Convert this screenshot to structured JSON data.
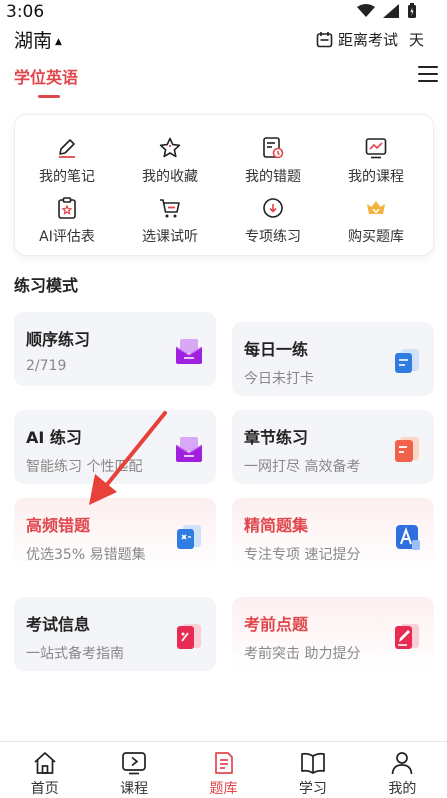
{
  "status": {
    "time": "3:06"
  },
  "header": {
    "region": "湖南",
    "exam_countdown": "距离考试",
    "days_suffix": "天"
  },
  "subject_tab": {
    "label": "学位英语",
    "accent": "#e0474c"
  },
  "quick_grid": [
    {
      "label": "我的笔记",
      "icon": "note-edit-icon"
    },
    {
      "label": "我的收藏",
      "icon": "star-icon"
    },
    {
      "label": "我的错题",
      "icon": "error-book-icon"
    },
    {
      "label": "我的课程",
      "icon": "course-chart-icon"
    },
    {
      "label": "AI评估表",
      "icon": "ai-assess-icon"
    },
    {
      "label": "选课试听",
      "icon": "cart-icon"
    },
    {
      "label": "专项练习",
      "icon": "cloud-download-icon"
    },
    {
      "label": "购买题库",
      "icon": "crown-icon"
    }
  ],
  "section_title": "练习模式",
  "practice_cards": [
    {
      "title": "顺序练习",
      "subtitle": "2/719",
      "style": "gray",
      "icon": "envelope-purple-icon"
    },
    {
      "title": "每日一练",
      "subtitle": "今日未打卡",
      "style": "gray",
      "icon": "calendar-blue-icon"
    },
    {
      "title": "AI 练习",
      "subtitle": "智能练习 个性匹配",
      "style": "gray",
      "icon": "envelope-purple-icon"
    },
    {
      "title": "章节练习",
      "subtitle": "一网打尽 高效备考",
      "style": "gray",
      "icon": "chapter-orange-icon"
    },
    {
      "title": "高频错题",
      "subtitle": "优选35% 易错题集",
      "style": "pink",
      "icon": "error-blue-icon"
    },
    {
      "title": "精简题集",
      "subtitle": "专注专项 速记提分",
      "style": "pink",
      "icon": "concise-blue-icon"
    },
    {
      "title": "考试信息",
      "subtitle": "一站式备考指南",
      "style": "gray",
      "icon": "info-red-icon"
    },
    {
      "title": "考前点题",
      "subtitle": "考前突击 助力提分",
      "style": "pink",
      "icon": "pen-red-icon"
    }
  ],
  "bottom_nav": [
    {
      "label": "首页",
      "icon": "home-icon",
      "active": false
    },
    {
      "label": "课程",
      "icon": "play-icon",
      "active": false
    },
    {
      "label": "题库",
      "icon": "question-bank-icon",
      "active": true
    },
    {
      "label": "学习",
      "icon": "book-icon",
      "active": false
    },
    {
      "label": "我的",
      "icon": "profile-icon",
      "active": false
    }
  ]
}
